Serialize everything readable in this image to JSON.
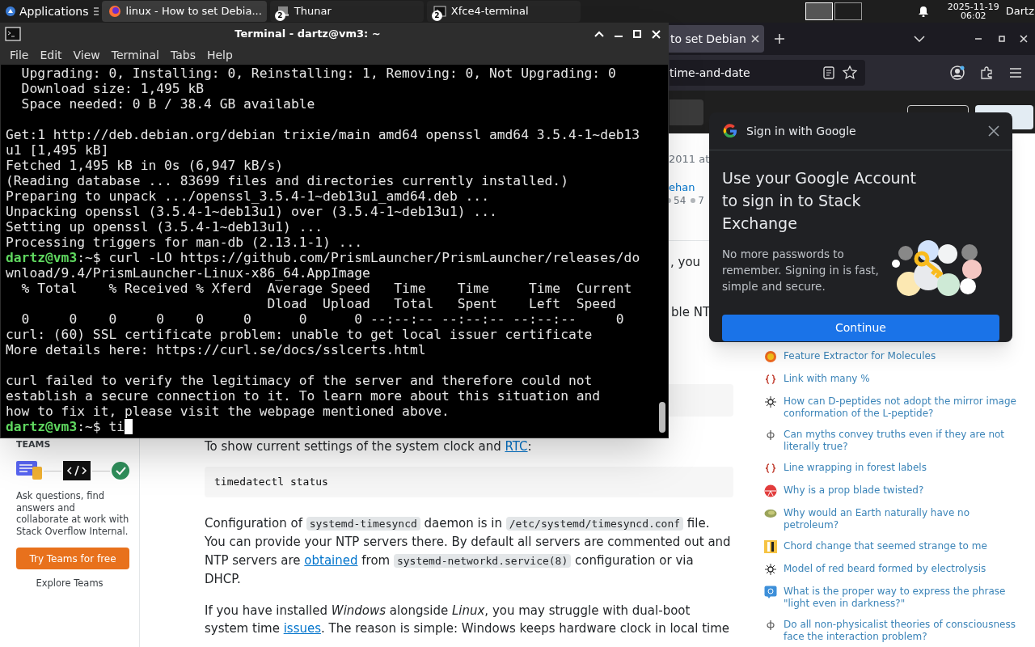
{
  "taskbar": {
    "menu_label": "Applications",
    "tasks": [
      {
        "kind": "browser",
        "label": "linux - How to set Debia...",
        "selected": true
      },
      {
        "kind": "files",
        "label": "Thunar",
        "badge": "2",
        "selected": false
      },
      {
        "kind": "terminal",
        "label": "Xfce4-terminal",
        "badge": "2",
        "selected": false
      }
    ],
    "clock": {
      "date": "2025-11-19",
      "time": "06:02"
    },
    "user": "Dartz"
  },
  "browser": {
    "tab": {
      "title": "to set Debian"
    },
    "address": "time-and-date",
    "post_meta": {
      "date": "2011 at",
      "user": "ehan",
      "badges": [
        "54",
        "7"
      ]
    },
    "fragments": [
      ", you",
      "ble NT"
    ],
    "article": {
      "intro": [
        {
          "kind": "text",
          "text": "To show current settings of the system clock and "
        },
        {
          "kind": "link",
          "text": "RTC"
        },
        {
          "kind": "text",
          "text": ":"
        }
      ],
      "code": "timedatectl status",
      "paragraphs": [
        [
          {
            "kind": "text",
            "text": "Configuration of "
          },
          {
            "kind": "code",
            "text": "systemd-timesyncd"
          },
          {
            "kind": "text",
            "text": " daemon is in "
          },
          {
            "kind": "code",
            "text": "/etc/systemd/timesyncd.conf"
          },
          {
            "kind": "text",
            "text": " file. You can provide your NTP servers there. By default all servers are commented out and NTP servers are "
          },
          {
            "kind": "link",
            "text": "obtained"
          },
          {
            "kind": "text",
            "text": " from "
          },
          {
            "kind": "code",
            "text": "systemd-networkd.service(8)"
          },
          {
            "kind": "text",
            "text": " configuration or via DHCP."
          }
        ],
        [
          {
            "kind": "text",
            "text": "If you have installed "
          },
          {
            "kind": "em",
            "text": "Windows"
          },
          {
            "kind": "text",
            "text": " alongside "
          },
          {
            "kind": "em",
            "text": "Linux"
          },
          {
            "kind": "text",
            "text": ", you may struggle with dual-boot system time "
          },
          {
            "kind": "link",
            "text": "issues"
          },
          {
            "kind": "text",
            "text": ". The reason is simple: Windows keeps hardware clock in local time"
          }
        ]
      ]
    },
    "teams": {
      "heading": "TEAMS",
      "text": "Ask questions, find answers and collaborate at work with Stack Overflow Internal.",
      "button": "Try Teams for free",
      "link": "Explore Teams"
    },
    "hot_network_questions": [
      {
        "kind": "sun",
        "title": "Feature Extractor for Molecules"
      },
      {
        "kind": "braces",
        "title": "Link with many %"
      },
      {
        "kind": "molecule",
        "title": "How can D-peptides not adopt the mirror image conformation of the L-peptide?"
      },
      {
        "kind": "phi",
        "title": "Can myths convey truths even if they are not literally true?"
      },
      {
        "kind": "braces",
        "title": "Line wrapping in forest labels"
      },
      {
        "kind": "disc",
        "title": "Why is a prop blade twisted?"
      },
      {
        "kind": "planet",
        "title": "Why would an Earth naturally have no petroleum?"
      },
      {
        "kind": "bars",
        "title": "Chord change that seemed strange to me"
      },
      {
        "kind": "molecule",
        "title": "Model of red beard formed by electrolysis"
      },
      {
        "kind": "chat",
        "title": "What is the proper way to express the phrase \"light even in darkness?\""
      },
      {
        "kind": "phi",
        "title": "Do all non-physicalist theories of consciousness face the interaction problem?"
      }
    ],
    "popup": {
      "title": "Sign in with Google",
      "heading": "Use your Google Account to sign in to Stack Exchange",
      "body": "No more passwords to remember. Signing in is fast, simple and secure.",
      "button": "Continue"
    }
  },
  "terminal": {
    "title": "Terminal - dartz@vm3: ~",
    "menu": [
      "File",
      "Edit",
      "View",
      "Terminal",
      "Tabs",
      "Help"
    ],
    "lines": [
      {
        "kind": "output",
        "text": "  Upgrading: 0, Installing: 0, Reinstalling: 1, Removing: 0, Not Upgrading: 0"
      },
      {
        "kind": "output",
        "text": "  Download size: 1,495 kB"
      },
      {
        "kind": "output",
        "text": "  Space needed: 0 B / 38.4 GB available"
      },
      {
        "kind": "blank"
      },
      {
        "kind": "output",
        "text": "Get:1 http://deb.debian.org/debian trixie/main amd64 openssl amd64 3.5.4-1~deb13"
      },
      {
        "kind": "output",
        "text": "u1 [1,495 kB]"
      },
      {
        "kind": "output",
        "text": "Fetched 1,495 kB in 0s (6,947 kB/s)"
      },
      {
        "kind": "output",
        "text": "(Reading database ... 83699 files and directories currently installed.)"
      },
      {
        "kind": "output",
        "text": "Preparing to unpack .../openssl_3.5.4-1~deb13u1_amd64.deb ..."
      },
      {
        "kind": "output",
        "text": "Unpacking openssl (3.5.4-1~deb13u1) over (3.5.4-1~deb13u1) ..."
      },
      {
        "kind": "output",
        "text": "Setting up openssl (3.5.4-1~deb13u1) ..."
      },
      {
        "kind": "output",
        "text": "Processing triggers for man-db (2.13.1-1) ..."
      },
      {
        "kind": "prompt",
        "prompt": "dartz@vm3",
        "text": ":~$ curl -LO https://github.com/PrismLauncher/PrismLauncher/releases/do"
      },
      {
        "kind": "output",
        "text": "wnload/9.4/PrismLauncher-Linux-x86_64.AppImage"
      },
      {
        "kind": "output",
        "text": "  % Total    % Received % Xferd  Average Speed   Time    Time     Time  Current"
      },
      {
        "kind": "output",
        "text": "                                 Dload  Upload   Total   Spent    Left  Speed"
      },
      {
        "kind": "output",
        "text": "  0     0    0     0    0     0      0      0 --:--:-- --:--:-- --:--:--     0"
      },
      {
        "kind": "output",
        "text": "curl: (60) SSL certificate problem: unable to get local issuer certificate"
      },
      {
        "kind": "output",
        "text": "More details here: https://curl.se/docs/sslcerts.html"
      },
      {
        "kind": "blank"
      },
      {
        "kind": "output",
        "text": "curl failed to verify the legitimacy of the server and therefore could not"
      },
      {
        "kind": "output",
        "text": "establish a secure connection to it. To learn more about this situation and"
      },
      {
        "kind": "output",
        "text": "how to fix it, please visit the webpage mentioned above."
      },
      {
        "kind": "prompt",
        "prompt": "dartz@vm3",
        "text": ":~$ ti",
        "cursor": true
      }
    ]
  }
}
